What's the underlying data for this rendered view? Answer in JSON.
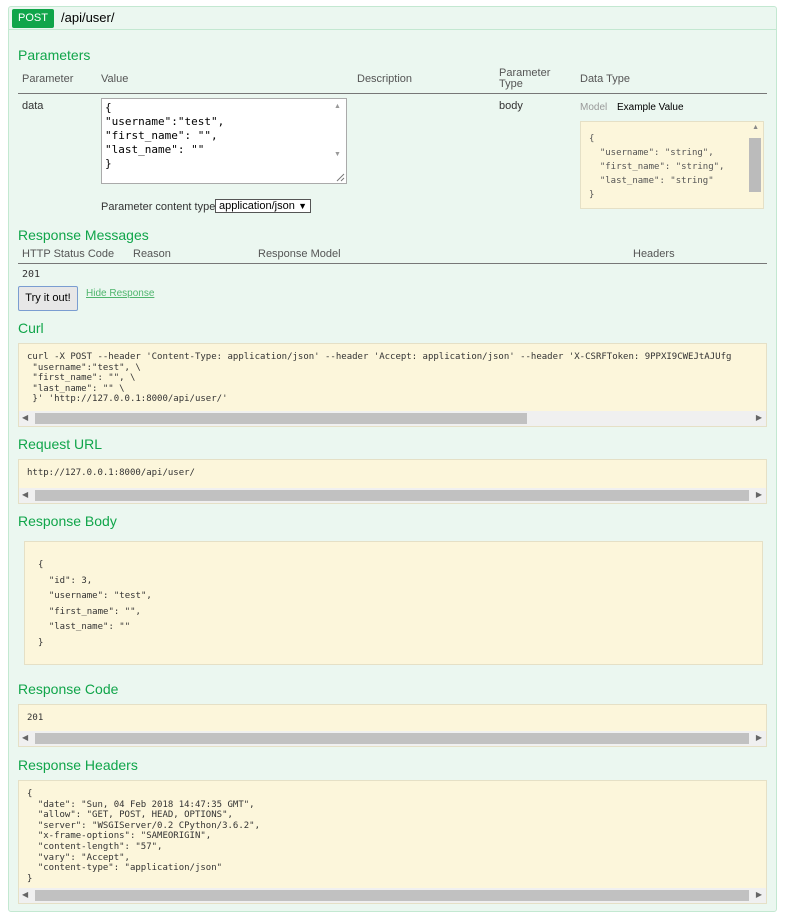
{
  "endpoint": {
    "method": "POST",
    "path": "/api/user/"
  },
  "parameters": {
    "title": "Parameters",
    "columns": {
      "parameter": "Parameter",
      "value": "Value",
      "description": "Description",
      "param_type": "Parameter\nType",
      "data_type": "Data Type"
    },
    "row": {
      "name": "data",
      "value": "{\n\"username\":\"test\",\n\"first_name\": \"\",\n\"last_name\": \"\"\n}",
      "param_type": "body"
    },
    "content_type_label": "Parameter content type:",
    "content_type_value": "application/json",
    "tabs": {
      "model": "Model",
      "example": "Example Value"
    },
    "example_value": "{\n  \"username\": \"string\",\n  \"first_name\": \"string\",\n  \"last_name\": \"string\"\n}"
  },
  "response_messages": {
    "title": "Response Messages",
    "columns": {
      "status": "HTTP Status Code",
      "reason": "Reason",
      "model": "Response Model",
      "headers": "Headers"
    },
    "status_value": "201"
  },
  "actions": {
    "try_label": "Try it out!",
    "hide_label": "Hide Response"
  },
  "curl": {
    "title": "Curl",
    "text": "curl -X POST --header 'Content-Type: application/json' --header 'Accept: application/json' --header 'X-CSRFToken: 9PPXI9CWEJtAJUfg\n \"username\":\"test\", \\\n \"first_name\": \"\", \\\n \"last_name\": \"\" \\\n }' 'http://127.0.0.1:8000/api/user/'"
  },
  "request_url": {
    "title": "Request URL",
    "text": "http://127.0.0.1:8000/api/user/"
  },
  "response_body": {
    "title": "Response Body",
    "text": "{\n  \"id\": 3,\n  \"username\": \"test\",\n  \"first_name\": \"\",\n  \"last_name\": \"\"\n}"
  },
  "response_code": {
    "title": "Response Code",
    "text": "201"
  },
  "response_headers": {
    "title": "Response Headers",
    "text": "{\n  \"date\": \"Sun, 04 Feb 2018 14:47:35 GMT\",\n  \"allow\": \"GET, POST, HEAD, OPTIONS\",\n  \"server\": \"WSGIServer/0.2 CPython/3.6.2\",\n  \"x-frame-options\": \"SAMEORIGIN\",\n  \"content-length\": \"57\",\n  \"vary\": \"Accept\",\n  \"content-type\": \"application/json\"\n}"
  },
  "colors": {
    "accent": "#10a54a",
    "panel_bg": "#ebf7f0",
    "code_bg": "#fcf6db"
  }
}
